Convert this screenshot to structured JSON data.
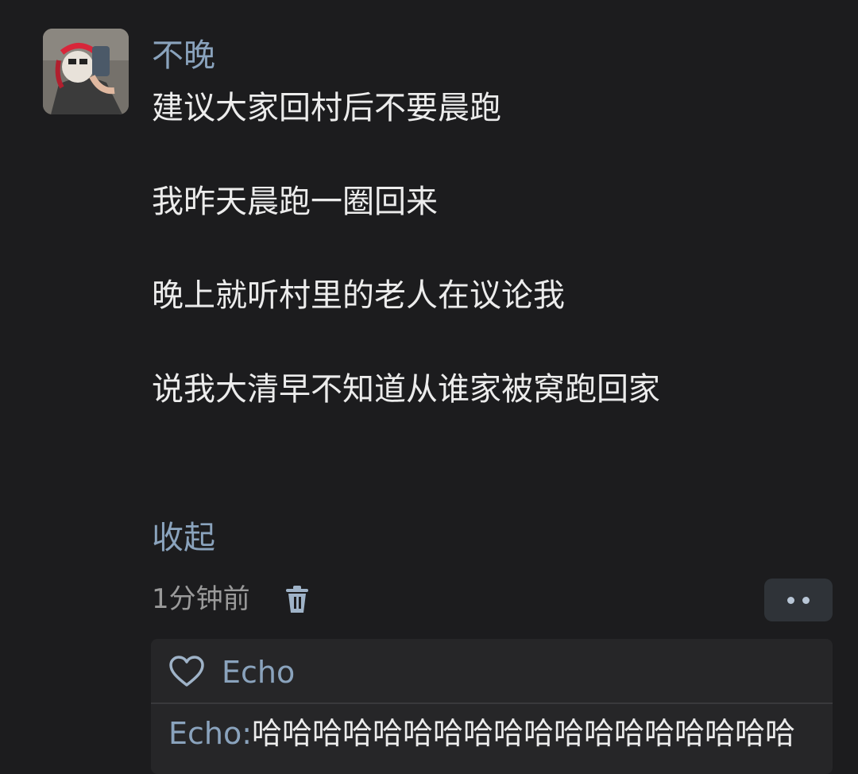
{
  "post": {
    "author": "不晚",
    "lines": [
      "建议大家回村后不要晨跑",
      "我昨天晨跑一圈回来",
      "晚上就听村里的老人在议论我",
      "说我大清早不知道从谁家被窝跑回家"
    ],
    "collapse_label": "收起",
    "timestamp": "1分钟前",
    "avatar_icon": "avatar-photo",
    "delete_icon": "trash-icon",
    "more_icon": "more-dots-icon"
  },
  "reactions": {
    "like_icon": "heart-outline-icon",
    "liked_by": "Echo"
  },
  "comments": [
    {
      "author": "Echo:",
      "text": "哈哈哈哈哈哈哈哈哈哈哈哈哈哈哈哈哈哈"
    }
  ],
  "colors": {
    "background": "#1c1c1e",
    "link": "#8aa3bd",
    "text": "#ececec",
    "muted": "#9a9a9a",
    "panel": "#262628"
  }
}
